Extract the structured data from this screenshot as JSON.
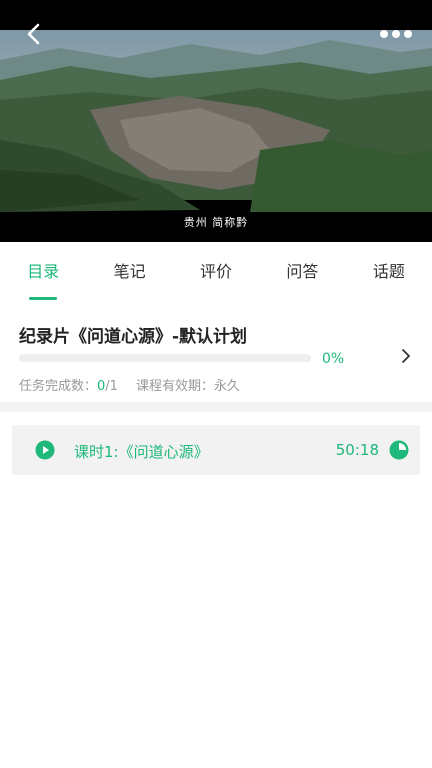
{
  "video": {
    "subtitle": "贵州 简称黔",
    "back_icon": "back-arrow-icon",
    "more_icon": "more-dots-icon"
  },
  "tabs": [
    {
      "label": "目录",
      "active": true
    },
    {
      "label": "笔记",
      "active": false
    },
    {
      "label": "评价",
      "active": false
    },
    {
      "label": "问答",
      "active": false
    },
    {
      "label": "话题",
      "active": false
    }
  ],
  "plan": {
    "title": "纪录片《问道心源》-默认计划",
    "progress": 0,
    "progress_text": "0%",
    "tasks_label": "任务完成数：",
    "tasks_done": "0",
    "tasks_total": "/1",
    "validity_label": "课程有效期：",
    "validity_value": "永久"
  },
  "lesson": {
    "title": "课时1:《问道心源》",
    "duration": "50:18",
    "play_icon": "play-circle-icon",
    "status_icon": "progress-pie-icon"
  },
  "colors": {
    "accent": "#1DB87A",
    "text": "#333333",
    "muted": "#999999"
  }
}
